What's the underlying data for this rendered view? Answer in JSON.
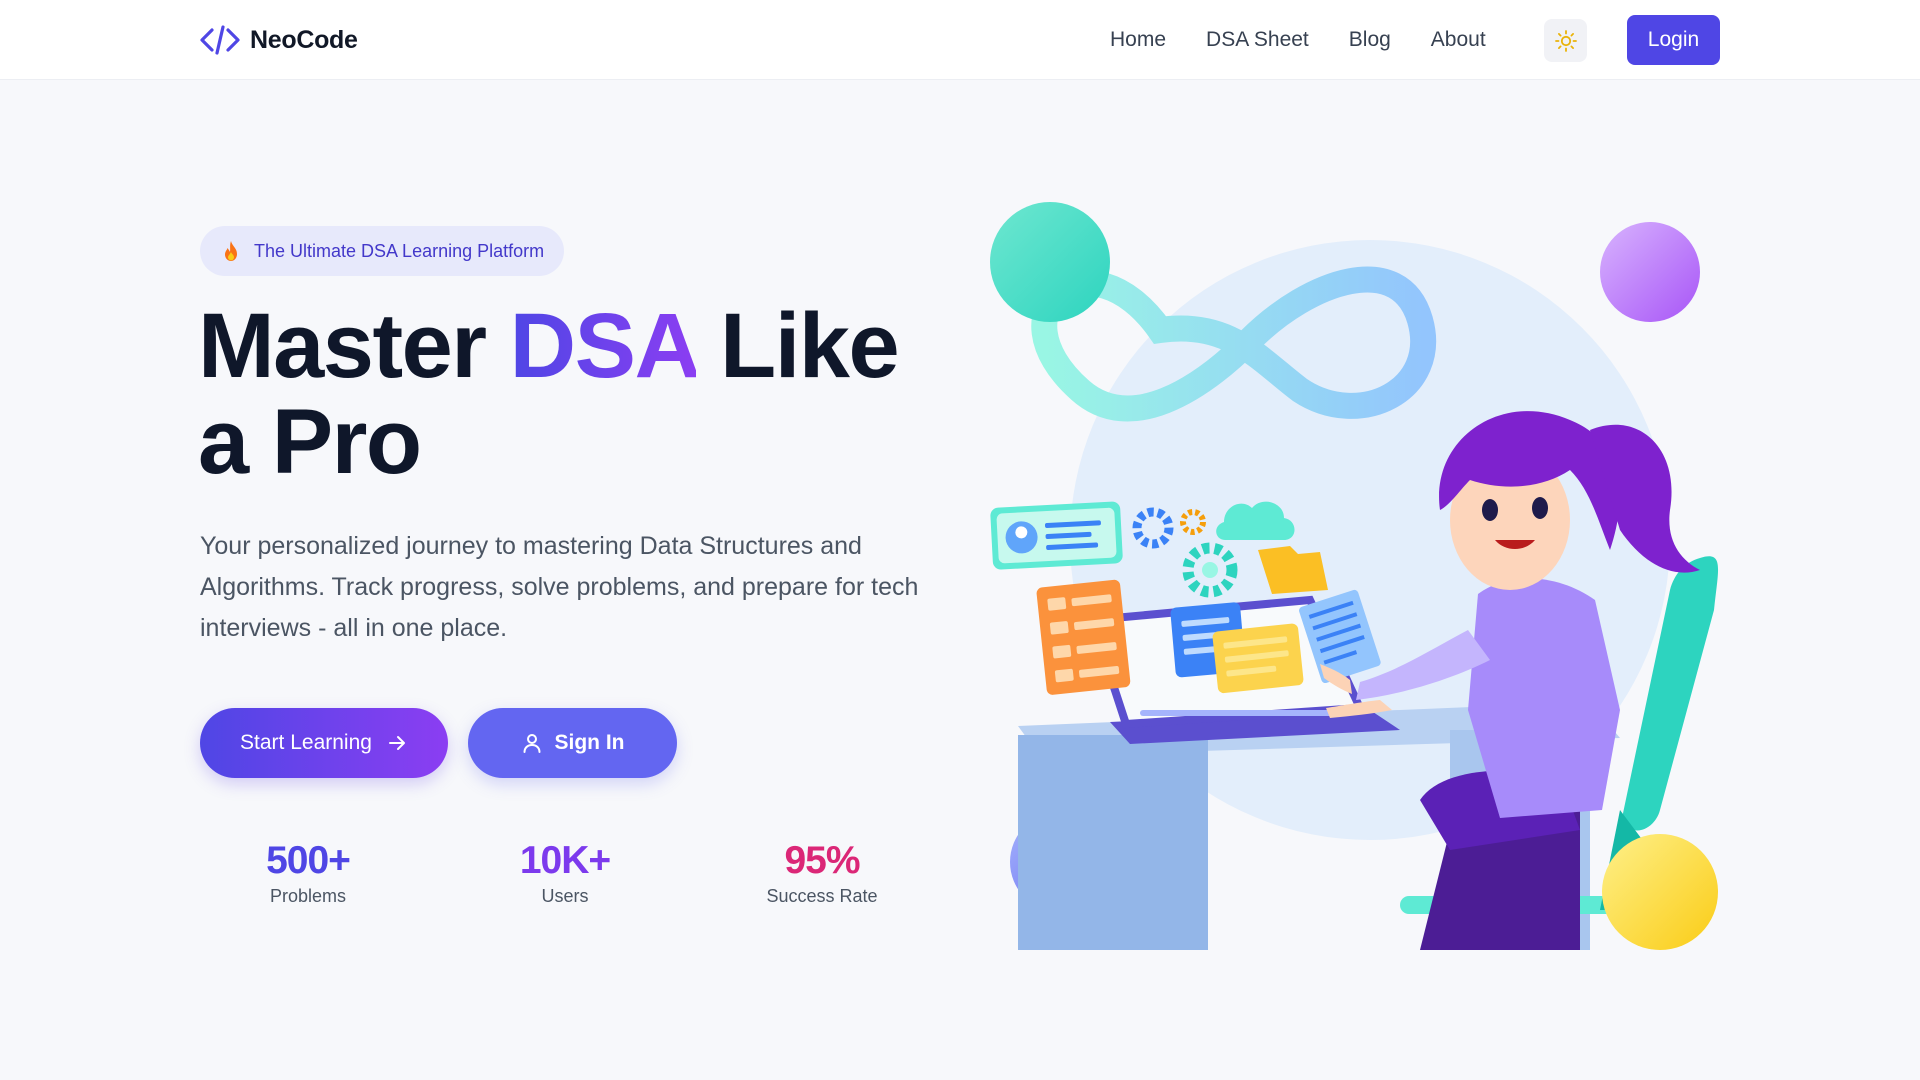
{
  "header": {
    "logo_text": "NeoCode",
    "nav": [
      "Home",
      "DSA Sheet",
      "Blog",
      "About"
    ],
    "login_label": "Login"
  },
  "hero": {
    "badge_icon": "fire-icon",
    "badge_text": "The Ultimate DSA Learning Platform",
    "headline_pre": "Master ",
    "headline_accent": "DSA",
    "headline_post": " Like a Pro",
    "subtitle": "Your personalized journey to mastering Data Structures and Algorithms. Track progress, solve problems, and prepare for tech interviews - all in one place.",
    "cta_primary": "Start Learning",
    "cta_secondary": "Sign In"
  },
  "stats": [
    {
      "value": "500+",
      "label": "Problems",
      "color": "#4f46e5"
    },
    {
      "value": "10K+",
      "label": "Users",
      "color": "#7c3aed"
    },
    {
      "value": "95%",
      "label": "Success Rate",
      "color": "#db2777"
    }
  ],
  "colors": {
    "brand": "#4f46e5",
    "accent": "#8b3ef2",
    "theme_icon": "sun-icon"
  }
}
